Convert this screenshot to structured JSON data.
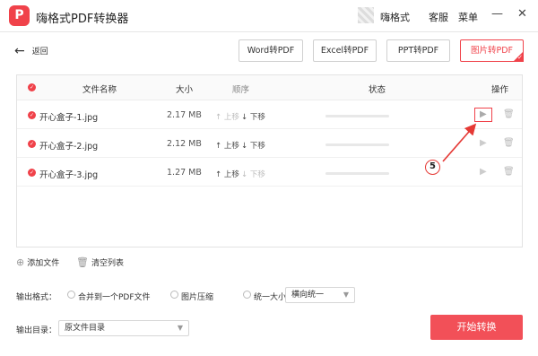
{
  "app": {
    "logo_text": "P",
    "title": "嗨格式PDF转换器"
  },
  "titlebar": {
    "username": "嗨格式",
    "service": "客服",
    "menu": "菜单",
    "minimize": "—",
    "close": "✕"
  },
  "back": {
    "label": "返回"
  },
  "tabs": [
    {
      "label": "Word转PDF",
      "active": false
    },
    {
      "label": "Excel转PDF",
      "active": false
    },
    {
      "label": "PPT转PDF",
      "active": false
    },
    {
      "label": "图片转PDF",
      "active": true
    }
  ],
  "table": {
    "headers": {
      "name": "文件名称",
      "size": "大小",
      "order": "顺序",
      "status": "状态",
      "action": "操作"
    },
    "move_up": "↑ 上移",
    "move_down": "↓ 下移",
    "rows": [
      {
        "name": "开心盒子-1.jpg",
        "size": "2.17 MB",
        "up_enabled": false,
        "down_enabled": true,
        "progress": 0
      },
      {
        "name": "开心盒子-2.jpg",
        "size": "2.12 MB",
        "up_enabled": true,
        "down_enabled": true,
        "progress": 0
      },
      {
        "name": "开心盒子-3.jpg",
        "size": "1.27 MB",
        "up_enabled": true,
        "down_enabled": false,
        "progress": 0
      }
    ]
  },
  "annotation": {
    "step": "5",
    "color": "#e53935"
  },
  "actions": {
    "add_file": "添加文件",
    "clear_list": "清空列表"
  },
  "output_format": {
    "label": "输出格式：",
    "options": [
      "合并到一个PDF文件",
      "图片压缩",
      "统一大小:"
    ],
    "size_select": "横向统一"
  },
  "output_dir": {
    "label": "输出目录：",
    "value": "原文件目录"
  },
  "start_button": "开始转换",
  "colors": {
    "accent": "#f0424a"
  }
}
